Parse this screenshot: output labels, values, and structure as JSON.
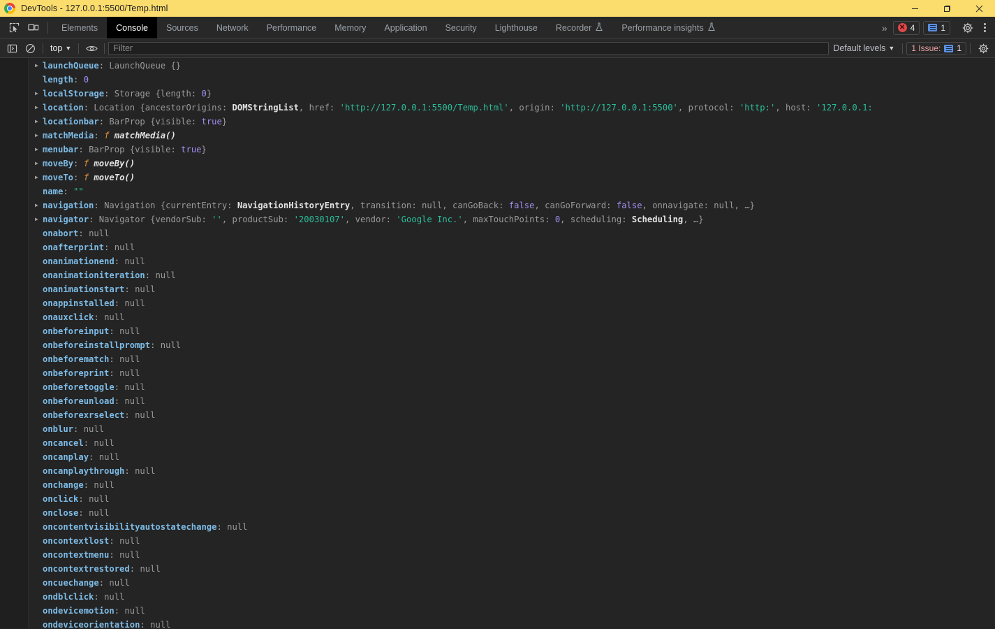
{
  "window": {
    "title": "DevTools - 127.0.0.1:5500/Temp.html",
    "logo_icon": "chrome-logo",
    "minimize_label": "–",
    "maximize_label": "❐",
    "close_label": "×"
  },
  "tabstrip": {
    "inspect_icon": "inspect-element-icon",
    "device_icon": "device-toolbar-icon",
    "tabs": [
      {
        "label": "Elements",
        "experimental": false,
        "active": false
      },
      {
        "label": "Console",
        "experimental": false,
        "active": true
      },
      {
        "label": "Sources",
        "experimental": false,
        "active": false
      },
      {
        "label": "Network",
        "experimental": false,
        "active": false
      },
      {
        "label": "Performance",
        "experimental": false,
        "active": false
      },
      {
        "label": "Memory",
        "experimental": false,
        "active": false
      },
      {
        "label": "Application",
        "experimental": false,
        "active": false
      },
      {
        "label": "Security",
        "experimental": false,
        "active": false
      },
      {
        "label": "Lighthouse",
        "experimental": false,
        "active": false
      },
      {
        "label": "Recorder",
        "experimental": true,
        "active": false
      },
      {
        "label": "Performance insights",
        "experimental": true,
        "active": false
      }
    ],
    "more_tabs_label": "»",
    "error_count": "4",
    "message_count": "1",
    "settings_icon": "gear-icon",
    "kebab_icon": "more-options-icon"
  },
  "console_toolbar": {
    "sidebar_icon": "console-sidebar-icon",
    "clear_icon": "clear-console-icon",
    "context": "top",
    "eye_icon": "live-expression-icon",
    "filter_placeholder": "Filter",
    "filter_value": "",
    "levels": "Default levels",
    "issues_label": "1 Issue:",
    "issues_count": "1",
    "settings_icon": "console-settings-icon"
  },
  "console_rows": [
    {
      "expandable": true,
      "segments": [
        {
          "t": "launchQueue",
          "c": "k-prop"
        },
        {
          "t": ": ",
          "c": "k-punct"
        },
        {
          "t": "LaunchQueue {}",
          "c": "k-ctor"
        }
      ]
    },
    {
      "expandable": false,
      "segments": [
        {
          "t": "length",
          "c": "k-prop"
        },
        {
          "t": ": ",
          "c": "k-punct"
        },
        {
          "t": "0",
          "c": "k-num"
        }
      ]
    },
    {
      "expandable": true,
      "segments": [
        {
          "t": "localStorage",
          "c": "k-prop"
        },
        {
          "t": ": ",
          "c": "k-punct"
        },
        {
          "t": "Storage {length: ",
          "c": "k-ctor"
        },
        {
          "t": "0",
          "c": "k-num"
        },
        {
          "t": "}",
          "c": "k-ctor"
        }
      ]
    },
    {
      "expandable": true,
      "segments": [
        {
          "t": "location",
          "c": "k-prop"
        },
        {
          "t": ": ",
          "c": "k-punct"
        },
        {
          "t": "Location {ancestorOrigins: ",
          "c": "k-ctor"
        },
        {
          "t": "DOMStringList",
          "c": "k-ctor-b"
        },
        {
          "t": ", href: ",
          "c": "k-ctor"
        },
        {
          "t": "'http://127.0.0.1:5500/Temp.html'",
          "c": "k-str"
        },
        {
          "t": ", origin: ",
          "c": "k-ctor"
        },
        {
          "t": "'http://127.0.0.1:5500'",
          "c": "k-str"
        },
        {
          "t": ", protocol: ",
          "c": "k-ctor"
        },
        {
          "t": "'http:'",
          "c": "k-str"
        },
        {
          "t": ", host: ",
          "c": "k-ctor"
        },
        {
          "t": "'127.0.0.1:",
          "c": "k-str"
        }
      ]
    },
    {
      "expandable": true,
      "segments": [
        {
          "t": "locationbar",
          "c": "k-prop"
        },
        {
          "t": ": ",
          "c": "k-punct"
        },
        {
          "t": "BarProp {visible: ",
          "c": "k-ctor"
        },
        {
          "t": "true",
          "c": "k-bool"
        },
        {
          "t": "}",
          "c": "k-ctor"
        }
      ]
    },
    {
      "expandable": true,
      "segments": [
        {
          "t": "matchMedia",
          "c": "k-prop"
        },
        {
          "t": ": ",
          "c": "k-punct"
        },
        {
          "t": "f ",
          "c": "k-fn"
        },
        {
          "t": "matchMedia()",
          "c": "k-fnname"
        }
      ]
    },
    {
      "expandable": true,
      "segments": [
        {
          "t": "menubar",
          "c": "k-prop"
        },
        {
          "t": ": ",
          "c": "k-punct"
        },
        {
          "t": "BarProp {visible: ",
          "c": "k-ctor"
        },
        {
          "t": "true",
          "c": "k-bool"
        },
        {
          "t": "}",
          "c": "k-ctor"
        }
      ]
    },
    {
      "expandable": true,
      "segments": [
        {
          "t": "moveBy",
          "c": "k-prop"
        },
        {
          "t": ": ",
          "c": "k-punct"
        },
        {
          "t": "f ",
          "c": "k-fn"
        },
        {
          "t": "moveBy()",
          "c": "k-fnname"
        }
      ]
    },
    {
      "expandable": true,
      "segments": [
        {
          "t": "moveTo",
          "c": "k-prop"
        },
        {
          "t": ": ",
          "c": "k-punct"
        },
        {
          "t": "f ",
          "c": "k-fn"
        },
        {
          "t": "moveTo()",
          "c": "k-fnname"
        }
      ]
    },
    {
      "expandable": false,
      "segments": [
        {
          "t": "name",
          "c": "k-prop"
        },
        {
          "t": ": ",
          "c": "k-punct"
        },
        {
          "t": "\"\"",
          "c": "k-str"
        }
      ]
    },
    {
      "expandable": true,
      "segments": [
        {
          "t": "navigation",
          "c": "k-prop"
        },
        {
          "t": ": ",
          "c": "k-punct"
        },
        {
          "t": "Navigation {currentEntry: ",
          "c": "k-ctor"
        },
        {
          "t": "NavigationHistoryEntry",
          "c": "k-ctor-b"
        },
        {
          "t": ", transition: ",
          "c": "k-ctor"
        },
        {
          "t": "null",
          "c": "k-null"
        },
        {
          "t": ", canGoBack: ",
          "c": "k-ctor"
        },
        {
          "t": "false",
          "c": "k-bool"
        },
        {
          "t": ", canGoForward: ",
          "c": "k-ctor"
        },
        {
          "t": "false",
          "c": "k-bool"
        },
        {
          "t": ", onnavigate: ",
          "c": "k-ctor"
        },
        {
          "t": "null",
          "c": "k-null"
        },
        {
          "t": ", …}",
          "c": "k-ctor"
        }
      ]
    },
    {
      "expandable": true,
      "segments": [
        {
          "t": "navigator",
          "c": "k-prop"
        },
        {
          "t": ": ",
          "c": "k-punct"
        },
        {
          "t": "Navigator {vendorSub: ",
          "c": "k-ctor"
        },
        {
          "t": "''",
          "c": "k-str"
        },
        {
          "t": ", productSub: ",
          "c": "k-ctor"
        },
        {
          "t": "'20030107'",
          "c": "k-str"
        },
        {
          "t": ", vendor: ",
          "c": "k-ctor"
        },
        {
          "t": "'Google Inc.'",
          "c": "k-str"
        },
        {
          "t": ", maxTouchPoints: ",
          "c": "k-ctor"
        },
        {
          "t": "0",
          "c": "k-num"
        },
        {
          "t": ", scheduling: ",
          "c": "k-ctor"
        },
        {
          "t": "Scheduling",
          "c": "k-ctor-b"
        },
        {
          "t": ", …}",
          "c": "k-ctor"
        }
      ]
    },
    {
      "expandable": false,
      "segments": [
        {
          "t": "onabort",
          "c": "k-prop"
        },
        {
          "t": ": ",
          "c": "k-punct"
        },
        {
          "t": "null",
          "c": "k-null"
        }
      ]
    },
    {
      "expandable": false,
      "segments": [
        {
          "t": "onafterprint",
          "c": "k-prop"
        },
        {
          "t": ": ",
          "c": "k-punct"
        },
        {
          "t": "null",
          "c": "k-null"
        }
      ]
    },
    {
      "expandable": false,
      "segments": [
        {
          "t": "onanimationend",
          "c": "k-prop"
        },
        {
          "t": ": ",
          "c": "k-punct"
        },
        {
          "t": "null",
          "c": "k-null"
        }
      ]
    },
    {
      "expandable": false,
      "segments": [
        {
          "t": "onanimationiteration",
          "c": "k-prop"
        },
        {
          "t": ": ",
          "c": "k-punct"
        },
        {
          "t": "null",
          "c": "k-null"
        }
      ]
    },
    {
      "expandable": false,
      "segments": [
        {
          "t": "onanimationstart",
          "c": "k-prop"
        },
        {
          "t": ": ",
          "c": "k-punct"
        },
        {
          "t": "null",
          "c": "k-null"
        }
      ]
    },
    {
      "expandable": false,
      "segments": [
        {
          "t": "onappinstalled",
          "c": "k-prop"
        },
        {
          "t": ": ",
          "c": "k-punct"
        },
        {
          "t": "null",
          "c": "k-null"
        }
      ]
    },
    {
      "expandable": false,
      "segments": [
        {
          "t": "onauxclick",
          "c": "k-prop"
        },
        {
          "t": ": ",
          "c": "k-punct"
        },
        {
          "t": "null",
          "c": "k-null"
        }
      ]
    },
    {
      "expandable": false,
      "segments": [
        {
          "t": "onbeforeinput",
          "c": "k-prop"
        },
        {
          "t": ": ",
          "c": "k-punct"
        },
        {
          "t": "null",
          "c": "k-null"
        }
      ]
    },
    {
      "expandable": false,
      "segments": [
        {
          "t": "onbeforeinstallprompt",
          "c": "k-prop"
        },
        {
          "t": ": ",
          "c": "k-punct"
        },
        {
          "t": "null",
          "c": "k-null"
        }
      ]
    },
    {
      "expandable": false,
      "segments": [
        {
          "t": "onbeforematch",
          "c": "k-prop"
        },
        {
          "t": ": ",
          "c": "k-punct"
        },
        {
          "t": "null",
          "c": "k-null"
        }
      ]
    },
    {
      "expandable": false,
      "segments": [
        {
          "t": "onbeforeprint",
          "c": "k-prop"
        },
        {
          "t": ": ",
          "c": "k-punct"
        },
        {
          "t": "null",
          "c": "k-null"
        }
      ]
    },
    {
      "expandable": false,
      "segments": [
        {
          "t": "onbeforetoggle",
          "c": "k-prop"
        },
        {
          "t": ": ",
          "c": "k-punct"
        },
        {
          "t": "null",
          "c": "k-null"
        }
      ]
    },
    {
      "expandable": false,
      "segments": [
        {
          "t": "onbeforeunload",
          "c": "k-prop"
        },
        {
          "t": ": ",
          "c": "k-punct"
        },
        {
          "t": "null",
          "c": "k-null"
        }
      ]
    },
    {
      "expandable": false,
      "segments": [
        {
          "t": "onbeforexrselect",
          "c": "k-prop"
        },
        {
          "t": ": ",
          "c": "k-punct"
        },
        {
          "t": "null",
          "c": "k-null"
        }
      ]
    },
    {
      "expandable": false,
      "segments": [
        {
          "t": "onblur",
          "c": "k-prop"
        },
        {
          "t": ": ",
          "c": "k-punct"
        },
        {
          "t": "null",
          "c": "k-null"
        }
      ]
    },
    {
      "expandable": false,
      "segments": [
        {
          "t": "oncancel",
          "c": "k-prop"
        },
        {
          "t": ": ",
          "c": "k-punct"
        },
        {
          "t": "null",
          "c": "k-null"
        }
      ]
    },
    {
      "expandable": false,
      "segments": [
        {
          "t": "oncanplay",
          "c": "k-prop"
        },
        {
          "t": ": ",
          "c": "k-punct"
        },
        {
          "t": "null",
          "c": "k-null"
        }
      ]
    },
    {
      "expandable": false,
      "segments": [
        {
          "t": "oncanplaythrough",
          "c": "k-prop"
        },
        {
          "t": ": ",
          "c": "k-punct"
        },
        {
          "t": "null",
          "c": "k-null"
        }
      ]
    },
    {
      "expandable": false,
      "segments": [
        {
          "t": "onchange",
          "c": "k-prop"
        },
        {
          "t": ": ",
          "c": "k-punct"
        },
        {
          "t": "null",
          "c": "k-null"
        }
      ]
    },
    {
      "expandable": false,
      "segments": [
        {
          "t": "onclick",
          "c": "k-prop"
        },
        {
          "t": ": ",
          "c": "k-punct"
        },
        {
          "t": "null",
          "c": "k-null"
        }
      ]
    },
    {
      "expandable": false,
      "segments": [
        {
          "t": "onclose",
          "c": "k-prop"
        },
        {
          "t": ": ",
          "c": "k-punct"
        },
        {
          "t": "null",
          "c": "k-null"
        }
      ]
    },
    {
      "expandable": false,
      "segments": [
        {
          "t": "oncontentvisibilityautostatechange",
          "c": "k-prop"
        },
        {
          "t": ": ",
          "c": "k-punct"
        },
        {
          "t": "null",
          "c": "k-null"
        }
      ]
    },
    {
      "expandable": false,
      "segments": [
        {
          "t": "oncontextlost",
          "c": "k-prop"
        },
        {
          "t": ": ",
          "c": "k-punct"
        },
        {
          "t": "null",
          "c": "k-null"
        }
      ]
    },
    {
      "expandable": false,
      "segments": [
        {
          "t": "oncontextmenu",
          "c": "k-prop"
        },
        {
          "t": ": ",
          "c": "k-punct"
        },
        {
          "t": "null",
          "c": "k-null"
        }
      ]
    },
    {
      "expandable": false,
      "segments": [
        {
          "t": "oncontextrestored",
          "c": "k-prop"
        },
        {
          "t": ": ",
          "c": "k-punct"
        },
        {
          "t": "null",
          "c": "k-null"
        }
      ]
    },
    {
      "expandable": false,
      "segments": [
        {
          "t": "oncuechange",
          "c": "k-prop"
        },
        {
          "t": ": ",
          "c": "k-punct"
        },
        {
          "t": "null",
          "c": "k-null"
        }
      ]
    },
    {
      "expandable": false,
      "segments": [
        {
          "t": "ondblclick",
          "c": "k-prop"
        },
        {
          "t": ": ",
          "c": "k-punct"
        },
        {
          "t": "null",
          "c": "k-null"
        }
      ]
    },
    {
      "expandable": false,
      "segments": [
        {
          "t": "ondevicemotion",
          "c": "k-prop"
        },
        {
          "t": ": ",
          "c": "k-punct"
        },
        {
          "t": "null",
          "c": "k-null"
        }
      ]
    },
    {
      "expandable": false,
      "segments": [
        {
          "t": "ondeviceorientation",
          "c": "k-prop"
        },
        {
          "t": ": ",
          "c": "k-punct"
        },
        {
          "t": "null",
          "c": "k-null"
        }
      ]
    }
  ]
}
